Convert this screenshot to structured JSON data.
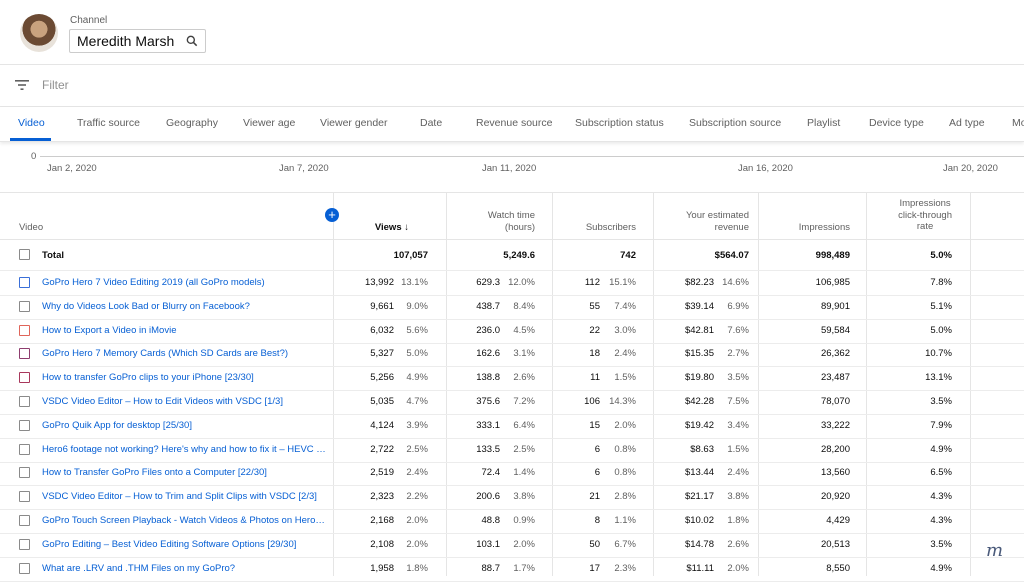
{
  "header": {
    "channel_label": "Channel",
    "channel_name": "Meredith Marsh"
  },
  "filter": {
    "placeholder": "Filter"
  },
  "tabs": [
    "Video",
    "Traffic source",
    "Geography",
    "Viewer age",
    "Viewer gender",
    "Date",
    "Revenue source",
    "Subscription status",
    "Subscription source",
    "Playlist",
    "Device type",
    "Ad type",
    "Mo"
  ],
  "chart": {
    "y_zero": "0",
    "x_labels": [
      "Jan 2, 2020",
      "Jan 7, 2020",
      "Jan 11, 2020",
      "Jan 16, 2020",
      "Jan 20, 2020"
    ]
  },
  "table": {
    "headers": {
      "video": "Video",
      "views": "Views",
      "watch_time_1": "Watch time",
      "watch_time_2": "(hours)",
      "subscribers": "Subscribers",
      "revenue_1": "Your estimated",
      "revenue_2": "revenue",
      "impressions": "Impressions",
      "ctr_1": "Impressions",
      "ctr_2": "click-through",
      "ctr_3": "rate"
    },
    "total": {
      "label": "Total",
      "views": "107,057",
      "watch": "5,249.6",
      "subs": "742",
      "revenue": "$564.07",
      "impressions": "998,489",
      "ctr": "5.0%"
    },
    "rows": [
      {
        "title": "GoPro Hero 7 Video Editing 2019 (all GoPro models)",
        "views": "13,992",
        "views_pct": "13.1%",
        "watch": "629.3",
        "watch_pct": "12.0%",
        "subs": "112",
        "subs_pct": "15.1%",
        "revenue": "$82.23",
        "rev_pct": "14.6%",
        "impressions": "106,985",
        "ctr": "7.8%",
        "color": "#3a6fd8"
      },
      {
        "title": "Why do Videos Look Bad or Blurry on Facebook?",
        "views": "9,661",
        "views_pct": "9.0%",
        "watch": "438.7",
        "watch_pct": "8.4%",
        "subs": "55",
        "subs_pct": "7.4%",
        "revenue": "$39.14",
        "rev_pct": "6.9%",
        "impressions": "89,901",
        "ctr": "5.1%",
        "color": "#8a8a8a"
      },
      {
        "title": "How to Export a Video in iMovie",
        "views": "6,032",
        "views_pct": "5.6%",
        "watch": "236.0",
        "watch_pct": "4.5%",
        "subs": "22",
        "subs_pct": "3.0%",
        "revenue": "$42.81",
        "rev_pct": "7.6%",
        "impressions": "59,584",
        "ctr": "5.0%",
        "color": "#e0655a"
      },
      {
        "title": "GoPro Hero 7 Memory Cards (Which SD Cards are Best?)",
        "views": "5,327",
        "views_pct": "5.0%",
        "watch": "162.6",
        "watch_pct": "3.1%",
        "subs": "18",
        "subs_pct": "2.4%",
        "revenue": "$15.35",
        "rev_pct": "2.7%",
        "impressions": "26,362",
        "ctr": "10.7%",
        "color": "#8e3d6e"
      },
      {
        "title": "How to transfer GoPro clips to your iPhone [23/30]",
        "views": "5,256",
        "views_pct": "4.9%",
        "watch": "138.8",
        "watch_pct": "2.6%",
        "subs": "11",
        "subs_pct": "1.5%",
        "revenue": "$19.80",
        "rev_pct": "3.5%",
        "impressions": "23,487",
        "ctr": "13.1%",
        "color": "#a8385c"
      },
      {
        "title": "VSDC Video Editor – How to Edit Videos with VSDC [1/3]",
        "views": "5,035",
        "views_pct": "4.7%",
        "watch": "375.6",
        "watch_pct": "7.2%",
        "subs": "106",
        "subs_pct": "14.3%",
        "revenue": "$42.28",
        "rev_pct": "7.5%",
        "impressions": "78,070",
        "ctr": "3.5%",
        "color": "#8a8a8a"
      },
      {
        "title": "GoPro Quik App for desktop [25/30]",
        "views": "4,124",
        "views_pct": "3.9%",
        "watch": "333.1",
        "watch_pct": "6.4%",
        "subs": "15",
        "subs_pct": "2.0%",
        "revenue": "$19.42",
        "rev_pct": "3.4%",
        "impressions": "33,222",
        "ctr": "7.9%",
        "color": "#8a8a8a"
      },
      {
        "title": "Hero6 footage not working? Here's why and how to fix it – HEVC H...",
        "views": "2,722",
        "views_pct": "2.5%",
        "watch": "133.5",
        "watch_pct": "2.5%",
        "subs": "6",
        "subs_pct": "0.8%",
        "revenue": "$8.63",
        "rev_pct": "1.5%",
        "impressions": "28,200",
        "ctr": "4.9%",
        "color": "#8a8a8a"
      },
      {
        "title": "How to Transfer GoPro Files onto a Computer [22/30]",
        "views": "2,519",
        "views_pct": "2.4%",
        "watch": "72.4",
        "watch_pct": "1.4%",
        "subs": "6",
        "subs_pct": "0.8%",
        "revenue": "$13.44",
        "rev_pct": "2.4%",
        "impressions": "13,560",
        "ctr": "6.5%",
        "color": "#8a8a8a"
      },
      {
        "title": "VSDC Video Editor – How to Trim and Split Clips with VSDC [2/3]",
        "views": "2,323",
        "views_pct": "2.2%",
        "watch": "200.6",
        "watch_pct": "3.8%",
        "subs": "21",
        "subs_pct": "2.8%",
        "revenue": "$21.17",
        "rev_pct": "3.8%",
        "impressions": "20,920",
        "ctr": "4.3%",
        "color": "#8a8a8a"
      },
      {
        "title": "GoPro Touch Screen Playback - Watch Videos & Photos on Hero 5 ...",
        "views": "2,168",
        "views_pct": "2.0%",
        "watch": "48.8",
        "watch_pct": "0.9%",
        "subs": "8",
        "subs_pct": "1.1%",
        "revenue": "$10.02",
        "rev_pct": "1.8%",
        "impressions": "4,429",
        "ctr": "4.3%",
        "color": "#8a8a8a"
      },
      {
        "title": "GoPro Editing – Best Video Editing Software Options [29/30]",
        "views": "2,108",
        "views_pct": "2.0%",
        "watch": "103.1",
        "watch_pct": "2.0%",
        "subs": "50",
        "subs_pct": "6.7%",
        "revenue": "$14.78",
        "rev_pct": "2.6%",
        "impressions": "20,513",
        "ctr": "3.5%",
        "color": "#8a8a8a"
      },
      {
        "title": "What are .LRV and .THM Files on my GoPro?",
        "views": "1,958",
        "views_pct": "1.8%",
        "watch": "88.7",
        "watch_pct": "1.7%",
        "subs": "17",
        "subs_pct": "2.3%",
        "revenue": "$11.11",
        "rev_pct": "2.0%",
        "impressions": "8,550",
        "ctr": "4.9%",
        "color": "#8a8a8a"
      }
    ]
  }
}
